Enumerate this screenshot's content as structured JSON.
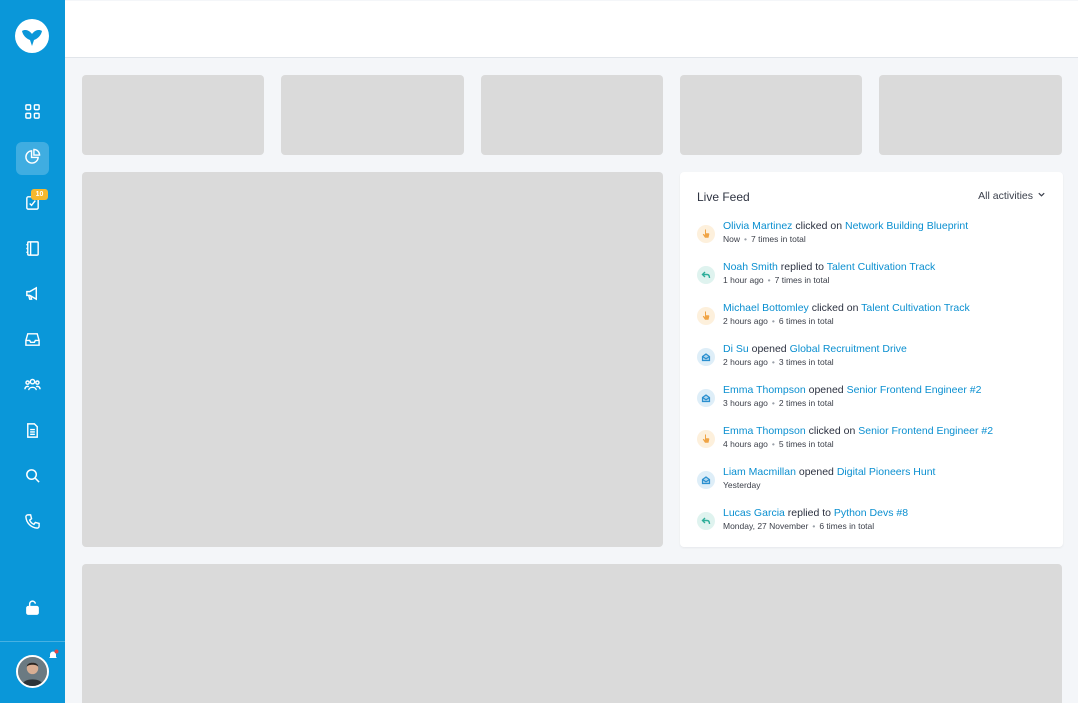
{
  "sidebar": {
    "badge_count": "10",
    "nav_icons": [
      "dashboard-grid-icon",
      "analytics-pie-icon",
      "tasks-checklist-icon",
      "contacts-book-icon",
      "campaigns-megaphone-icon",
      "inbox-icon",
      "team-people-icon",
      "documents-icon",
      "search-icon",
      "phone-icon"
    ],
    "lock_icon": "unlock-icon",
    "active_item": "analytics-pie-icon"
  },
  "colors": {
    "sidebar": "#0a97d9",
    "link": "#0a8fd0",
    "badge": "#f5b82e",
    "skeleton": "#dadada"
  },
  "live_feed": {
    "title": "Live Feed",
    "filter_label": "All activities",
    "items": [
      {
        "type": "click",
        "person": "Olivia Martinez",
        "action": "clicked on",
        "target": "Network Building Blueprint",
        "time": "Now",
        "count": "7 times in total"
      },
      {
        "type": "reply",
        "person": "Noah Smith",
        "action": "replied to",
        "target": "Talent Cultivation Track",
        "time": "1 hour ago",
        "count": "7 times in total"
      },
      {
        "type": "click",
        "person": "Michael Bottomley",
        "action": "clicked on",
        "target": "Talent Cultivation Track",
        "time": "2 hours ago",
        "count": "6 times in total"
      },
      {
        "type": "open",
        "person": "Di Su",
        "action": "opened",
        "target": "Global Recruitment Drive",
        "time": "2 hours ago",
        "count": "3 times in total"
      },
      {
        "type": "open",
        "person": "Emma Thompson",
        "action": "opened",
        "target": "Senior Frontend Engineer #2",
        "time": "3 hours ago",
        "count": "2 times in total"
      },
      {
        "type": "click",
        "person": "Emma Thompson",
        "action": "clicked on",
        "target": "Senior Frontend Engineer #2",
        "time": "4 hours ago",
        "count": "5 times in total"
      },
      {
        "type": "open",
        "person": "Liam Macmillan",
        "action": "opened",
        "target": "Digital Pioneers Hunt",
        "time": "Yesterday",
        "count": ""
      },
      {
        "type": "reply",
        "person": "Lucas Garcia",
        "action": "replied to",
        "target": "Python Devs #8",
        "time": "Monday, 27 November",
        "count": "6 times in total"
      }
    ]
  }
}
